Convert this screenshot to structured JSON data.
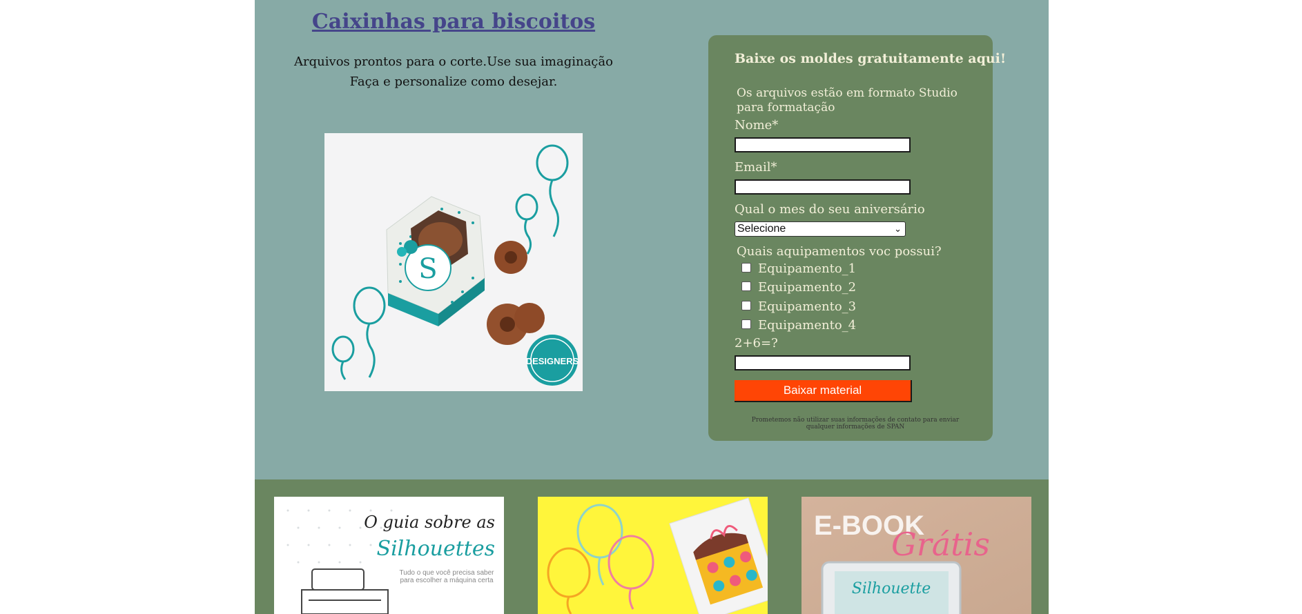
{
  "hero": {
    "title": "Caixinhas para biscoitos",
    "desc_line1": "Arquivos prontos para o corte.Use sua imaginação",
    "desc_line2": "Faça e personalize como desejar.",
    "image_logo_text": "DESIGNERS"
  },
  "form": {
    "title": "Baixe os moldes gratuitamente aqui!",
    "intro": "Os arquivos estão em formato Studio para formatação",
    "name_label": "Nome*",
    "name_value": "",
    "email_label": "Email*",
    "email_value": "",
    "birthday_label": "Qual o mes do seu aniversário",
    "birthday_selected": "Selecione",
    "equipment_label": "Quais aquipamentos voc possui?",
    "equipment_options": [
      "Equipamento_1",
      "Equipamento_2",
      "Equipamento_3",
      "Equipamento_4"
    ],
    "captcha_label": "2+6=?",
    "captcha_value": "",
    "submit_label": "Baixar material",
    "disclaimer_line1": "Prometemos não utilizar suas informações de contato para enviar",
    "disclaimer_line2": "qualquer informações de SPAN"
  },
  "thumbnails": {
    "guide_line1": "O guia sobre as",
    "guide_line2": "Silhouettes",
    "guide_caption": "Tudo o que você precisa saber para escolher a máquina certa",
    "ebook_line1": "E-BOOK",
    "ebook_line2": "Grátis",
    "ebook_small": "Silhouette"
  },
  "colors": {
    "page_bg": "#87aaa6",
    "form_bg": "#6a8660",
    "title_color": "#45458a",
    "submit_bg": "#ff4505",
    "accent_teal": "#1a9ea0"
  }
}
